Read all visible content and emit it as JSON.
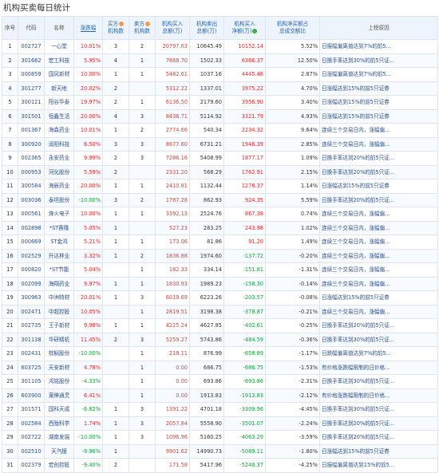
{
  "title": "机构买卖每日统计",
  "headers": {
    "idx": "序号",
    "code": "代码",
    "name": "名称",
    "change": "涨跌幅",
    "buy_count_1": "买方",
    "buy_count_2": "机构数",
    "sell_count_1": "卖方",
    "sell_count_2": "机构数",
    "buy_amt_1": "机构买入",
    "buy_amt_2": "总额(万)",
    "sell_amt_1": "机构卖出",
    "sell_amt_2": "总额(万)",
    "net_1": "机构买入",
    "net_2": "净额(万)",
    "ratio_1": "机构净买额占",
    "ratio_2": "总成交额比",
    "reason": "上榜原因"
  },
  "rows": [
    {
      "idx": "1",
      "code": "002727",
      "name": "一心堂",
      "change": "10.01%",
      "buy_n": "3",
      "sell_n": "2",
      "buy": "20797.63",
      "sell": "10645.49",
      "net": "10152.14",
      "ratio": "5.52%",
      "reason": "日振幅偏离值达到7%的前5..."
    },
    {
      "idx": "2",
      "code": "301662",
      "name": "宏工科技",
      "change": "5.95%",
      "buy_n": "4",
      "sell_n": "1",
      "buy": "7868.70",
      "sell": "1502.33",
      "net": "6366.37",
      "ratio": "12.50%",
      "reason": "日换手率达到30%的前5只证..."
    },
    {
      "idx": "3",
      "code": "000859",
      "name": "国风新材",
      "change": "10.00%",
      "buy_n": "1",
      "sell_n": "1",
      "buy": "5482.61",
      "sell": "1037.16",
      "net": "4445.46",
      "ratio": "2.87%",
      "reason": "日涨幅偏离值达到7%的前5..."
    },
    {
      "idx": "4",
      "code": "301277",
      "name": "新天地",
      "change": "20.02%",
      "buy_n": "2",
      "sell_n": "",
      "buy": "5312.22",
      "sell": "1337.01",
      "net": "3975.22",
      "ratio": "4.70%",
      "reason": "日涨幅达到15%的前5只证券"
    },
    {
      "idx": "5",
      "code": "300121",
      "name": "阳谷华泰",
      "change": "19.97%",
      "buy_n": "2",
      "sell_n": "1",
      "buy": "6136.50",
      "sell": "2179.60",
      "net": "3956.90",
      "ratio": "3.40%",
      "reason": "日涨幅达到15%的前5只证券"
    },
    {
      "idx": "6",
      "code": "301501",
      "name": "恒鑫生活",
      "change": "20.00%",
      "buy_n": "4",
      "sell_n": "3",
      "buy": "8436.71",
      "sell": "5114.92",
      "net": "3321.79",
      "ratio": "4.93%",
      "reason": "日涨幅达到15%的前5只证券"
    },
    {
      "idx": "7",
      "code": "001367",
      "name": "海森药业",
      "change": "10.01%",
      "buy_n": "1",
      "sell_n": "2",
      "buy": "2774.66",
      "sell": "540.34",
      "net": "2234.32",
      "ratio": "9.64%",
      "reason": "连续三个交易日内，涨幅偏..."
    },
    {
      "idx": "8",
      "code": "300920",
      "name": "润阳科技",
      "change": "6.50%",
      "buy_n": "3",
      "sell_n": "3",
      "buy": "8677.60",
      "sell": "6731.21",
      "net": "1946.39",
      "ratio": "2.85%",
      "reason": "连续三个交易日内，涨幅偏..."
    },
    {
      "idx": "9",
      "code": "002365",
      "name": "永安药业",
      "change": "9.99%",
      "buy_n": "2",
      "sell_n": "3",
      "buy": "7286.16",
      "sell": "5408.99",
      "net": "1877.17",
      "ratio": "1.09%",
      "reason": "日换手率达到20%的前5只证..."
    },
    {
      "idx": "10",
      "code": "000953",
      "name": "河化股份",
      "change": "5.59%",
      "buy_n": "2",
      "sell_n": "",
      "buy": "2331.20",
      "sell": "568.29",
      "net": "1762.91",
      "ratio": "2.15%",
      "reason": "日换手率达到20%的前5只证..."
    },
    {
      "idx": "11",
      "code": "300584",
      "name": "海辰药业",
      "change": "20.00%",
      "buy_n": "1",
      "sell_n": "1",
      "buy": "2410.81",
      "sell": "1132.44",
      "net": "1278.37",
      "ratio": "1.14%",
      "reason": "日涨幅达到15%的前5只证券"
    },
    {
      "idx": "12",
      "code": "003036",
      "name": "泰坦股份",
      "change": "-10.00%",
      "buy_n": "3",
      "sell_n": "2",
      "buy": "1787.28",
      "sell": "862.93",
      "net": "924.35",
      "ratio": "5.59%",
      "reason": "日换手率达到20%的前5只证..."
    },
    {
      "idx": "13",
      "code": "000561",
      "name": "烽火电子",
      "change": "10.00%",
      "buy_n": "1",
      "sell_n": "1",
      "buy": "3392.13",
      "sell": "2524.76",
      "net": "867.38",
      "ratio": "0.74%",
      "reason": "连续三个交易日内，涨幅偏..."
    },
    {
      "idx": "14",
      "code": "002898",
      "name": "*ST赛隆",
      "change": "5.05%",
      "buy_n": "1",
      "sell_n": "",
      "buy": "527.23",
      "sell": "283.25",
      "net": "243.98",
      "ratio": "1.02%",
      "reason": "连续三个交易日内，涨幅偏..."
    },
    {
      "idx": "15",
      "code": "000669",
      "code_note": "",
      "name": "ST金鸿",
      "change": "5.21%",
      "buy_n": "1",
      "sell_n": "1",
      "buy": "173.06",
      "sell": "81.86",
      "net": "91.20",
      "ratio": "1.49%",
      "reason": "连续三个交易日内，涨幅偏..."
    },
    {
      "idx": "16",
      "code": "002529",
      "name": "升达林业",
      "change": "3.32%",
      "buy_n": "1",
      "sell_n": "2",
      "buy": "1836.88",
      "sell": "1974.60",
      "net": "-137.72",
      "ratio": "-0.20%",
      "reason": "连续三个交易日内，涨幅偏..."
    },
    {
      "idx": "17",
      "code": "000820",
      "name": "*ST节能",
      "change": "5.04%",
      "buy_n": "",
      "sell_n": "1",
      "buy": "182.33",
      "sell": "334.14",
      "net": "-151.81",
      "ratio": "-1.31%",
      "reason": "连续三个交易日内，涨幅偏..."
    },
    {
      "idx": "18",
      "code": "002099",
      "name": "海翔药业",
      "change": "9.97%",
      "buy_n": "1",
      "sell_n": "1",
      "buy": "1830.93",
      "sell": "1989.23",
      "net": "-158.30",
      "ratio": "-0.14%",
      "reason": "连续三个交易日内，涨幅偏..."
    },
    {
      "idx": "19",
      "code": "300963",
      "name": "中洲特材",
      "change": "20.01%",
      "buy_n": "1",
      "sell_n": "3",
      "buy": "6019.69",
      "sell": "6223.26",
      "net": "-203.57",
      "ratio": "-0.08%",
      "reason": "日涨幅达到15%的前5只证券"
    },
    {
      "idx": "20",
      "code": "002471",
      "name": "中超控股",
      "change": "10.05%",
      "buy_n": "",
      "sell_n": "1",
      "buy": "2819.51",
      "sell": "3198.38",
      "net": "-378.87",
      "ratio": "-0.21%",
      "reason": "连续三个交易日内，涨幅偏..."
    },
    {
      "idx": "21",
      "code": "002735",
      "name": "王子新材",
      "change": "9.98%",
      "buy_n": "1",
      "sell_n": "1",
      "buy": "4225.24",
      "sell": "4627.85",
      "net": "-402.61",
      "ratio": "-0.25%",
      "reason": "日换手率达到20%的前5只证..."
    },
    {
      "idx": "22",
      "code": "301138",
      "name": "华研精机",
      "change": "11.45%",
      "buy_n": "2",
      "sell_n": "3",
      "buy": "5259.27",
      "sell": "5743.86",
      "net": "-484.59",
      "ratio": "-0.36%",
      "reason": "日换手率达到30%的前5只证..."
    },
    {
      "idx": "23",
      "code": "002431",
      "name": "棕榈股份",
      "change": "-10.00%",
      "buy_n": "",
      "sell_n": "1",
      "buy": "218.11",
      "sell": "876.99",
      "net": "-658.89",
      "ratio": "-1.17%",
      "reason": "日跌幅偏离值达到7%的前5..."
    },
    {
      "idx": "24",
      "code": "603725",
      "name": "天安新材",
      "change": "4.78%",
      "buy_n": "",
      "sell_n": "1",
      "buy": "0.00",
      "sell": "686.75",
      "net": "-686.75",
      "ratio": "-1.53%",
      "reason": "有价格涨跌幅限制的日价格..."
    },
    {
      "idx": "25",
      "code": "301105",
      "name": "鸿铭股份",
      "change": "-4.33%",
      "buy_n": "",
      "sell_n": "1",
      "buy": "0.00",
      "sell": "693.86",
      "net": "-693.86",
      "ratio": "-2.31%",
      "reason": "日换手率达到30%的前5只证..."
    },
    {
      "idx": "26",
      "code": "603900",
      "name": "莱绅通灵",
      "change": "6.41%",
      "buy_n": "",
      "sell_n": "1",
      "buy": "0.00",
      "sell": "1913.83",
      "net": "-1913.83",
      "ratio": "-2.12%",
      "reason": "有价格涨跌幅限制的日价格..."
    },
    {
      "idx": "27",
      "code": "301571",
      "name": "国科天成",
      "change": "-6.82%",
      "buy_n": "1",
      "sell_n": "3",
      "buy": "1391.22",
      "sell": "4701.18",
      "net": "-3309.96",
      "ratio": "-4.45%",
      "reason": "日换手率达到30%的前5只证..."
    },
    {
      "idx": "28",
      "code": "002584",
      "name": "西陇科学",
      "change": "1.74%",
      "buy_n": "1",
      "sell_n": "3",
      "buy": "2057.84",
      "sell": "5558.90",
      "net": "-3501.07",
      "ratio": "-2.24%",
      "reason": "日换手率达到20%的前5只证..."
    },
    {
      "idx": "29",
      "code": "002722",
      "name": "湖南发展",
      "change": "-10.00%",
      "buy_n": "1",
      "sell_n": "3",
      "buy": "1096.96",
      "sell": "5160.25",
      "net": "-4063.29",
      "ratio": "-3.59%",
      "reason": "日换手率达到20%的前5只证..."
    },
    {
      "idx": "30",
      "code": "002510",
      "name": "天汽模",
      "change": "-9.96%",
      "buy_n": "1",
      "sell_n": "",
      "buy": "9901.62",
      "sell": "14990.73",
      "net": "-5089.11",
      "ratio": "-1.80%",
      "reason": "日涨幅达到15%的前5只证券"
    },
    {
      "idx": "31",
      "code": "002379",
      "name": "宏创控股",
      "change": "-9.40%",
      "buy_n": "2",
      "sell_n": "",
      "buy": "171.58",
      "sell": "5417.96",
      "net": "-5246.37",
      "ratio": "-4.25%",
      "reason": "日振幅偏离值达到15%的前5..."
    }
  ],
  "colors": {
    "up": "#e22222",
    "down": "#13a13a",
    "buy": "#d4453b",
    "link": "#2a4e8c",
    "header_bg": "#eef4fb",
    "border": "#dfe5ee"
  },
  "icons": {
    "sort_indicator": "sort-arrow-icon",
    "info": "info-dot-icon"
  }
}
